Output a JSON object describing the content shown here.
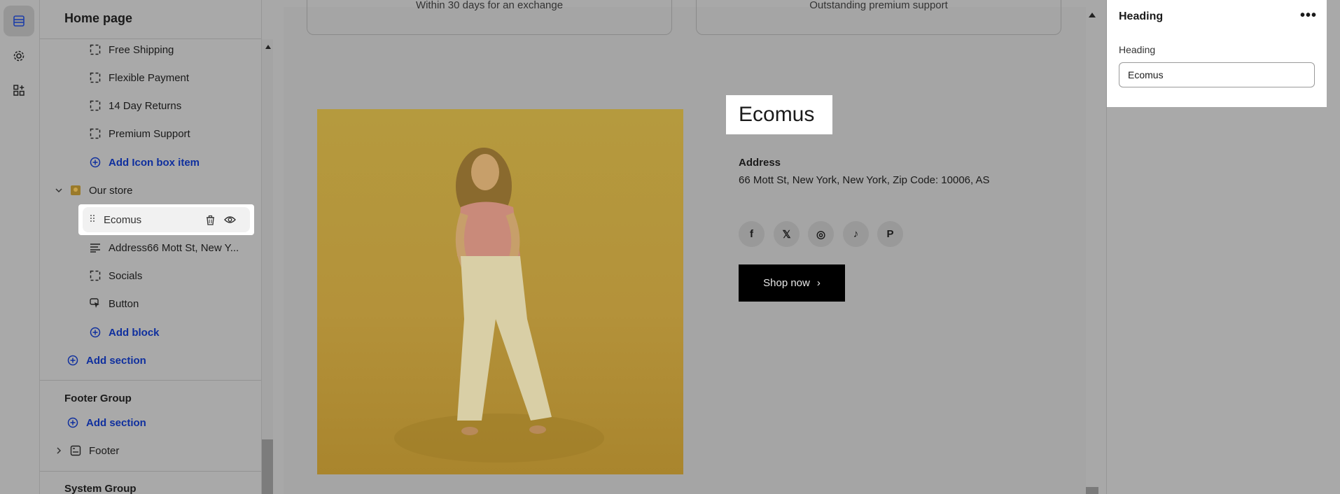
{
  "sidebar": {
    "title": "Home page",
    "items": [
      {
        "label": "Free Shipping"
      },
      {
        "label": "Flexible Payment"
      },
      {
        "label": "14 Day Returns"
      },
      {
        "label": "Premium Support"
      },
      {
        "label": "Add Icon box item"
      }
    ],
    "store_section": "Our store",
    "store_blocks": [
      {
        "label": "Ecomus"
      },
      {
        "label": "Address66 Mott St, New Y..."
      },
      {
        "label": "Socials"
      },
      {
        "label": "Button"
      },
      {
        "label": "Add block"
      }
    ],
    "add_section": "Add section",
    "footer_group": "Footer Group",
    "footer_add_section": "Add section",
    "footer": "Footer",
    "system_group": "System Group"
  },
  "preview": {
    "card_left_text": "Within 30 days for an exchange",
    "card_right_text": "Outstanding premium support",
    "heading": "Ecomus",
    "address_label": "Address",
    "address_text": "66 Mott St, New York, New York, Zip Code: 10006, AS",
    "socials": [
      {
        "icon": "facebook-icon",
        "glyph": "f"
      },
      {
        "icon": "x-icon",
        "glyph": "𝕏"
      },
      {
        "icon": "instagram-icon",
        "glyph": "◎"
      },
      {
        "icon": "tiktok-icon",
        "glyph": "♪"
      },
      {
        "icon": "pinterest-icon",
        "glyph": "P"
      }
    ],
    "button_label": "Shop now",
    "button_arrow": "›"
  },
  "panel": {
    "title": "Heading",
    "more": "•••",
    "field_label": "Heading",
    "field_value": "Ecomus"
  }
}
